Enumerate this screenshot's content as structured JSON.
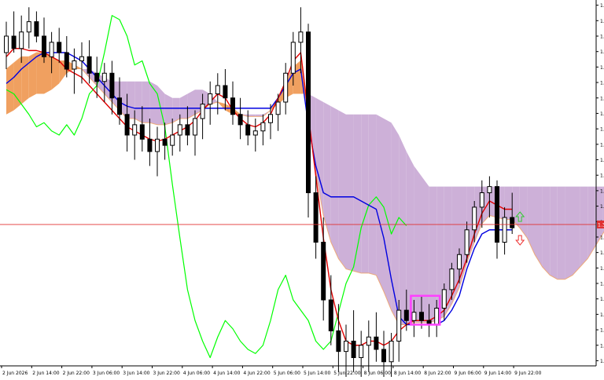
{
  "chart_data": {
    "type": "candlestick",
    "instrument_symbol": "",
    "y_ticks": [
      "1.34830",
      "1.34755",
      "1.34680",
      "1.34605",
      "1.34530",
      "1.34455",
      "1.34380",
      "1.34305",
      "1.34230",
      "1.34155",
      "1.34080",
      "1.34005",
      "1.33930",
      "1.33855",
      "1.33780",
      "1.33705",
      "1.33630",
      "1.33555",
      "1.33480",
      "1.33405",
      "1.33330",
      "1.33255",
      "1.33180",
      "1.33105"
    ],
    "x_ticks": [
      "2 Jun 2026",
      "2 Jun 14:00",
      "2 Jun 22:00",
      "3 Jun 06:00",
      "3 Jun 14:00",
      "3 Jun 22:00",
      "4 Jun 06:00",
      "4 Jun 14:00",
      "4 Jun 22:00",
      "5 Jun 06:00",
      "5 Jun 14:00",
      "5 Jun 22:00",
      "8 Jun 06:00",
      "8 Jun 14:00",
      "8 Jun 22:00",
      "9 Jun 06:00",
      "9 Jun 14:00",
      "9 Jun 22:00"
    ],
    "ylim": [
      1.3308,
      1.3484
    ],
    "current_price": {
      "value": 1.33766,
      "label": "1.33766",
      "line_color": "#e03030",
      "label_bg": "#e03030"
    },
    "colors": {
      "tenkan": "#e00000",
      "kijun": "#0000e0",
      "chikou": "#00ff00",
      "cloud_bull": "#f0a060",
      "cloud_bear": "#cdb0d8",
      "span_a_line": "#f0a060",
      "candle": "#000000",
      "highlight_box": "#ff40ff",
      "arrow_up": "#33cc33",
      "arrow_down": "#ee3333"
    },
    "candles": [
      [
        1.346,
        1.3475,
        1.3452,
        1.3468
      ],
      [
        1.3468,
        1.348,
        1.346,
        1.3462
      ],
      [
        1.3462,
        1.3478,
        1.3455,
        1.347
      ],
      [
        1.347,
        1.3482,
        1.3462,
        1.3475
      ],
      [
        1.3475,
        1.348,
        1.3465,
        1.3468
      ],
      [
        1.3468,
        1.3477,
        1.3455,
        1.3458
      ],
      [
        1.3458,
        1.347,
        1.345,
        1.3465
      ],
      [
        1.3465,
        1.3472,
        1.3455,
        1.346
      ],
      [
        1.346,
        1.3468,
        1.3448,
        1.3452
      ],
      [
        1.3452,
        1.3462,
        1.344,
        1.3456
      ],
      [
        1.3456,
        1.3465,
        1.3445,
        1.3458
      ],
      [
        1.3458,
        1.3466,
        1.3445,
        1.345
      ],
      [
        1.345,
        1.3458,
        1.3438,
        1.3446
      ],
      [
        1.3446,
        1.3455,
        1.3436,
        1.345
      ],
      [
        1.345,
        1.3456,
        1.343,
        1.3438
      ],
      [
        1.3438,
        1.3448,
        1.3425,
        1.343
      ],
      [
        1.343,
        1.344,
        1.3412,
        1.342
      ],
      [
        1.342,
        1.3432,
        1.3408,
        1.3425
      ],
      [
        1.3425,
        1.3434,
        1.3412,
        1.3418
      ],
      [
        1.3418,
        1.3428,
        1.3405,
        1.3412
      ],
      [
        1.3412,
        1.3424,
        1.34,
        1.3418
      ],
      [
        1.3418,
        1.3426,
        1.3408,
        1.3415
      ],
      [
        1.3415,
        1.3428,
        1.341,
        1.342
      ],
      [
        1.342,
        1.343,
        1.3412,
        1.3425
      ],
      [
        1.3425,
        1.3434,
        1.3415,
        1.342
      ],
      [
        1.342,
        1.3432,
        1.341,
        1.3428
      ],
      [
        1.3428,
        1.344,
        1.3418,
        1.3435
      ],
      [
        1.3435,
        1.3446,
        1.3425,
        1.344
      ],
      [
        1.344,
        1.345,
        1.343,
        1.3444
      ],
      [
        1.3444,
        1.3452,
        1.3432,
        1.3438
      ],
      [
        1.3438,
        1.3446,
        1.3425,
        1.343
      ],
      [
        1.343,
        1.3438,
        1.3418,
        1.3425
      ],
      [
        1.3425,
        1.3432,
        1.3415,
        1.342
      ],
      [
        1.342,
        1.3428,
        1.3412,
        1.3422
      ],
      [
        1.3422,
        1.343,
        1.3415,
        1.3426
      ],
      [
        1.3426,
        1.3435,
        1.3418,
        1.343
      ],
      [
        1.343,
        1.344,
        1.3422,
        1.3436
      ],
      [
        1.3436,
        1.3455,
        1.343,
        1.345
      ],
      [
        1.345,
        1.347,
        1.3444,
        1.3465
      ],
      [
        1.3465,
        1.3482,
        1.345,
        1.347
      ],
      [
        1.347,
        1.3474,
        1.338,
        1.3392
      ],
      [
        1.3392,
        1.34,
        1.336,
        1.3368
      ],
      [
        1.3368,
        1.338,
        1.333,
        1.334
      ],
      [
        1.334,
        1.3352,
        1.3318,
        1.3325
      ],
      [
        1.3325,
        1.3338,
        1.3305,
        1.3315
      ],
      [
        1.3315,
        1.3328,
        1.33,
        1.332
      ],
      [
        1.332,
        1.3335,
        1.3305,
        1.3312
      ],
      [
        1.3312,
        1.3325,
        1.3296,
        1.3318
      ],
      [
        1.3318,
        1.333,
        1.3305,
        1.3322
      ],
      [
        1.3322,
        1.3334,
        1.331,
        1.3316
      ],
      [
        1.3316,
        1.3325,
        1.3302,
        1.331
      ],
      [
        1.331,
        1.3324,
        1.3298,
        1.332
      ],
      [
        1.332,
        1.334,
        1.331,
        1.3335
      ],
      [
        1.3335,
        1.3345,
        1.3325,
        1.333
      ],
      [
        1.333,
        1.334,
        1.3322,
        1.3334
      ],
      [
        1.3334,
        1.3342,
        1.3326,
        1.333
      ],
      [
        1.333,
        1.3338,
        1.3322,
        1.3328
      ],
      [
        1.3328,
        1.334,
        1.3322,
        1.3336
      ],
      [
        1.3336,
        1.3348,
        1.333,
        1.3345
      ],
      [
        1.3345,
        1.3358,
        1.334,
        1.3355
      ],
      [
        1.3355,
        1.3365,
        1.3348,
        1.3362
      ],
      [
        1.3362,
        1.3378,
        1.3358,
        1.3374
      ],
      [
        1.3374,
        1.3388,
        1.3368,
        1.3385
      ],
      [
        1.3385,
        1.3398,
        1.3375,
        1.3392
      ],
      [
        1.3392,
        1.34,
        1.338,
        1.3395
      ],
      [
        1.3395,
        1.3398,
        1.336,
        1.3368
      ],
      [
        1.3368,
        1.3385,
        1.3362,
        1.338
      ],
      [
        1.338,
        1.3392,
        1.3372,
        1.3375
      ]
    ],
    "tenkan": [
      1.3458,
      1.3462,
      1.3462,
      1.3461,
      1.3461,
      1.346,
      1.3458,
      1.3456,
      1.3452,
      1.345,
      1.3448,
      1.3444,
      1.344,
      1.3436,
      1.3432,
      1.3428,
      1.3424,
      1.3422,
      1.342,
      1.3418,
      1.3417,
      1.3418,
      1.342,
      1.3422,
      1.3424,
      1.3427,
      1.3432,
      1.3436,
      1.344,
      1.3438,
      1.3432,
      1.3428,
      1.3425,
      1.3424,
      1.3426,
      1.343,
      1.3438,
      1.3446,
      1.3456,
      1.346,
      1.343,
      1.34,
      1.337,
      1.3345,
      1.333,
      1.332,
      1.3318,
      1.3318,
      1.332,
      1.332,
      1.3318,
      1.332,
      1.3325,
      1.3328,
      1.333,
      1.333,
      1.333,
      1.3332,
      1.3335,
      1.3342,
      1.335,
      1.336,
      1.3372,
      1.3382,
      1.3388,
      1.3386,
      1.3384,
      1.3384
    ],
    "kijun": [
      1.3445,
      1.3448,
      1.3452,
      1.3455,
      1.3458,
      1.346,
      1.346,
      1.346,
      1.346,
      1.3458,
      1.3456,
      1.3452,
      1.3448,
      1.3444,
      1.344,
      1.3436,
      1.3434,
      1.3433,
      1.3433,
      1.3433,
      1.3433,
      1.3433,
      1.3433,
      1.3433,
      1.3433,
      1.3433,
      1.3433,
      1.3433,
      1.3433,
      1.3433,
      1.3433,
      1.3433,
      1.3433,
      1.3433,
      1.3433,
      1.3433,
      1.3438,
      1.3444,
      1.345,
      1.3452,
      1.3425,
      1.3405,
      1.3392,
      1.339,
      1.339,
      1.339,
      1.339,
      1.3388,
      1.3386,
      1.3384,
      1.337,
      1.335,
      1.3332,
      1.3328,
      1.3328,
      1.3328,
      1.3328,
      1.3328,
      1.333,
      1.3335,
      1.3342,
      1.3355,
      1.3365,
      1.3372,
      1.3374,
      1.3374,
      1.3374,
      1.3374
    ],
    "chikou": [
      1.3442,
      1.344,
      1.3435,
      1.343,
      1.3424,
      1.3426,
      1.3422,
      1.342,
      1.3425,
      1.342,
      1.3428,
      1.344,
      1.3444,
      1.346,
      1.3478,
      1.3476,
      1.3468,
      1.3454,
      1.3456,
      1.3445,
      1.344,
      1.3424,
      1.3396,
      1.337,
      1.3345,
      1.333,
      1.332,
      1.3312,
      1.3322,
      1.333,
      1.3326,
      1.332,
      1.3316,
      1.3314,
      1.3318,
      1.333,
      1.3345,
      1.3352,
      1.334,
      1.3335,
      1.333,
      1.332,
      1.3316,
      1.332,
      1.3334,
      1.3348,
      1.3356,
      1.3375,
      1.3386,
      1.339,
      1.3385,
      1.3372,
      1.338,
      1.3376
    ],
    "span_a": [
      1.3452,
      1.3455,
      1.3458,
      1.3458,
      1.346,
      1.346,
      1.3458,
      1.3456,
      1.3456,
      1.3454,
      1.3452,
      1.3448,
      1.3444,
      1.344,
      1.3436,
      1.3432,
      1.3428,
      1.3428,
      1.3426,
      1.3426,
      1.3425,
      1.3425,
      1.3426,
      1.3428,
      1.3428,
      1.343,
      1.3432,
      1.3435,
      1.3436,
      1.3435,
      1.3433,
      1.343,
      1.3429,
      1.3429,
      1.3429,
      1.3432,
      1.3438,
      1.3445,
      1.3453,
      1.3456,
      1.3428,
      1.3402,
      1.3381,
      1.3368,
      1.336,
      1.3355,
      1.3354,
      1.3353,
      1.3353,
      1.3352,
      1.3344,
      1.3335,
      1.3328,
      1.3328,
      1.3329,
      1.3329,
      1.3329,
      1.333,
      1.3332,
      1.3338,
      1.3346,
      1.3358,
      1.3368,
      1.3377,
      1.3381,
      1.338,
      1.3379,
      1.3379,
      1.3375,
      1.337,
      1.3362,
      1.3356,
      1.3352,
      1.335,
      1.335,
      1.3352,
      1.3356,
      1.336,
      1.3366,
      1.3372,
      1.3378,
      1.3382,
      1.3385
    ],
    "span_b": [
      1.343,
      1.3432,
      1.3435,
      1.3438,
      1.344,
      1.344,
      1.3442,
      1.3445,
      1.345,
      1.3452,
      1.3452,
      1.3452,
      1.345,
      1.3448,
      1.3446,
      1.3446,
      1.3446,
      1.3446,
      1.3446,
      1.3446,
      1.3444,
      1.344,
      1.3438,
      1.3438,
      1.344,
      1.3442,
      1.3442,
      1.344,
      1.3436,
      1.3432,
      1.343,
      1.343,
      1.343,
      1.343,
      1.343,
      1.3432,
      1.3435,
      1.3438,
      1.344,
      1.344,
      1.344,
      1.3438,
      1.3436,
      1.3434,
      1.3432,
      1.343,
      1.343,
      1.343,
      1.343,
      1.343,
      1.3428,
      1.3426,
      1.342,
      1.3412,
      1.3405,
      1.34,
      1.3395,
      1.3395,
      1.3395,
      1.3395,
      1.3395,
      1.3395,
      1.3395,
      1.3395,
      1.3395,
      1.3395,
      1.3395,
      1.3395,
      1.3395,
      1.3395,
      1.3395,
      1.3395,
      1.3395,
      1.3395,
      1.3395,
      1.3395,
      1.3395,
      1.3395,
      1.3395,
      1.3395,
      1.3395,
      1.3395,
      1.3395
    ],
    "highlight_box": {
      "from_candle": 54,
      "to_candle": 57,
      "low": 1.3328,
      "high": 1.3342
    },
    "signal_arrows": {
      "up_near": 1.338,
      "down_near": 1.3372
    }
  }
}
